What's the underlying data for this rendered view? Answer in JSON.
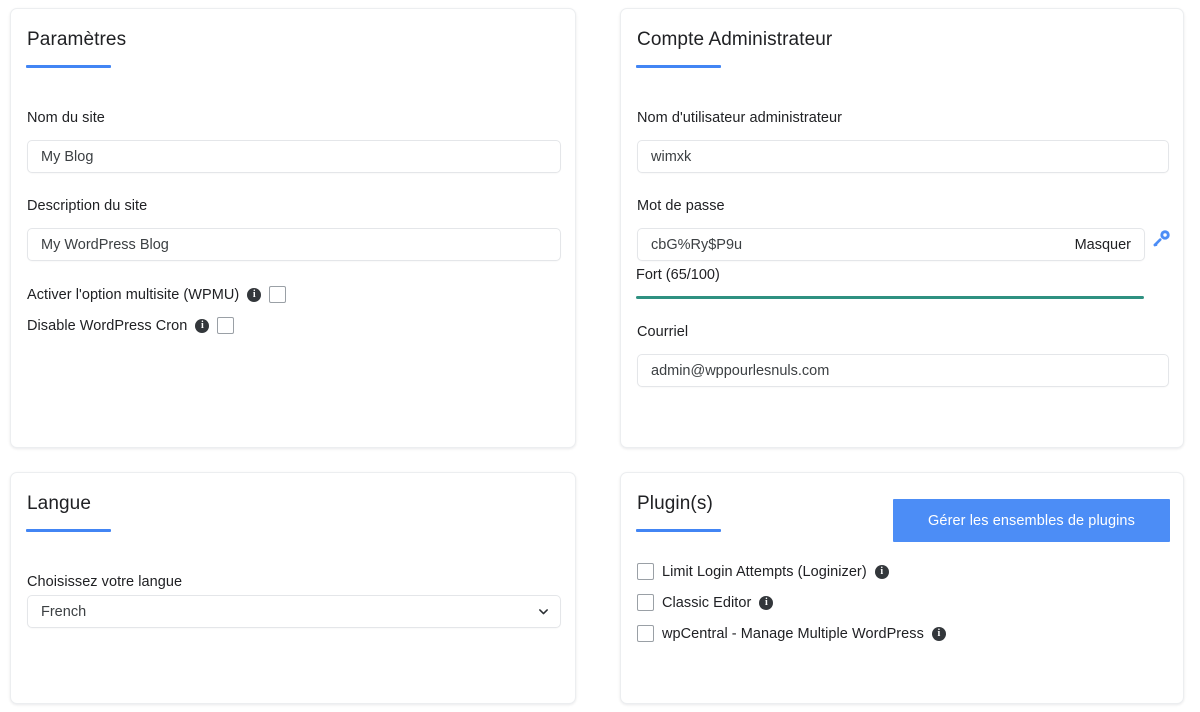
{
  "theme": {
    "accent_blue": "#4285f4",
    "button_blue": "#4c8df6",
    "strength_teal": "#2f9181",
    "text": "#202124",
    "card_border": "#eceef0"
  },
  "settings": {
    "title": "Paramètres",
    "site_name_label": "Nom du site",
    "site_name_value": "My Blog",
    "site_desc_label": "Description du site",
    "site_desc_value": "My WordPress Blog",
    "multisite_label": "Activer l'option multisite (WPMU)",
    "multisite_info_icon": "info-icon",
    "multisite_checked": false,
    "cron_label": "Disable WordPress Cron",
    "cron_info_icon": "info-icon",
    "cron_checked": false
  },
  "admin": {
    "title": "Compte Administrateur",
    "username_label": "Nom d'utilisateur administrateur",
    "username_value": "wimxk",
    "password_label": "Mot de passe",
    "password_value": "cbG%Ry$P9u",
    "password_toggle_label": "Masquer",
    "password_key_icon": "key-icon",
    "strength_label": "Fort (65/100)",
    "strength_score": 65,
    "strength_max": 100,
    "email_label": "Courriel",
    "email_value": "admin@wppourlesnuls.com"
  },
  "language": {
    "title": "Langue",
    "choose_label": "Choisissez votre langue",
    "selected": "French",
    "chevron_icon": "chevron-down-icon"
  },
  "plugins": {
    "title": "Plugin(s)",
    "manage_button_label": "Gérer les ensembles de plugins",
    "items": [
      {
        "label": "Limit Login Attempts (Loginizer)",
        "checked": false,
        "info_icon": "info-icon"
      },
      {
        "label": "Classic Editor",
        "checked": false,
        "info_icon": "info-icon"
      },
      {
        "label": "wpCentral - Manage Multiple WordPress",
        "checked": false,
        "info_icon": "info-icon"
      }
    ]
  }
}
